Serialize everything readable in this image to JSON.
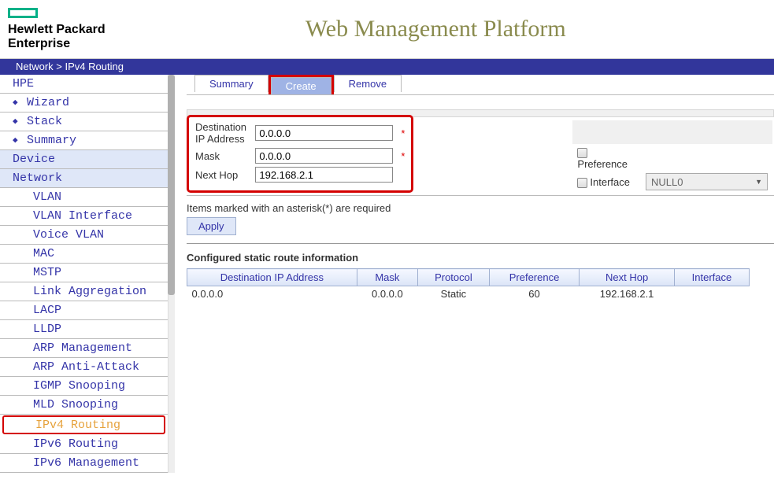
{
  "brand": {
    "line1": "Hewlett Packard",
    "line2": "Enterprise"
  },
  "pageTitle": "Web Management Platform",
  "breadcrumb": "Network > IPv4 Routing",
  "sidebar": {
    "root": "HPE",
    "wizard": "Wizard",
    "stack": "Stack",
    "summary": "Summary",
    "device": "Device",
    "network": "Network",
    "items": {
      "vlan": "VLAN",
      "vlanIf": "VLAN Interface",
      "voiceVlan": "Voice VLAN",
      "mac": "MAC",
      "mstp": "MSTP",
      "linkAgg": "Link Aggregation",
      "lacp": "LACP",
      "lldp": "LLDP",
      "arpMgmt": "ARP Management",
      "arpAnti": "ARP Anti-Attack",
      "igmp": "IGMP Snooping",
      "mld": "MLD Snooping",
      "ipv4r": "IPv4 Routing",
      "ipv6r": "IPv6 Routing",
      "ipv6m": "IPv6 Management"
    }
  },
  "tabs": {
    "summary": "Summary",
    "create": "Create",
    "remove": "Remove"
  },
  "form": {
    "destLabel": "Destination IP Address",
    "destVal": "0.0.0.0",
    "maskLabel": "Mask",
    "maskVal": "0.0.0.0",
    "nextHopLabel": "Next Hop",
    "nextHopVal": "192.168.2.1",
    "prefLabel": "Preference",
    "ifaceLabel": "Interface",
    "ifaceVal": "NULL0"
  },
  "note": "Items marked with an asterisk(*) are required",
  "applyLabel": "Apply",
  "sectionTitle": "Configured static route information",
  "tableHeaders": {
    "dest": "Destination IP Address",
    "mask": "Mask",
    "protocol": "Protocol",
    "pref": "Preference",
    "nexthop": "Next Hop",
    "iface": "Interface"
  },
  "tableRows": [
    {
      "dest": "0.0.0.0",
      "mask": "0.0.0.0",
      "protocol": "Static",
      "pref": "60",
      "nexthop": "192.168.2.1",
      "iface": ""
    }
  ]
}
